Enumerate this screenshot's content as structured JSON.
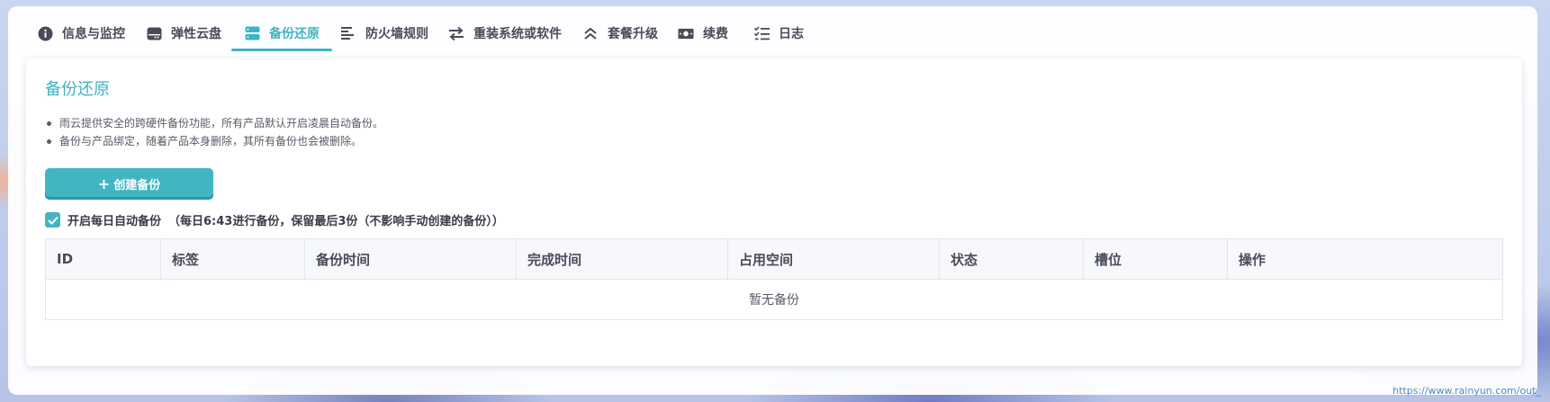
{
  "tabs": [
    {
      "label": "信息与监控",
      "icon": "info-icon",
      "active": false
    },
    {
      "label": "弹性云盘",
      "icon": "disk-icon",
      "active": false
    },
    {
      "label": "备份还原",
      "icon": "server-icon",
      "active": true
    },
    {
      "label": "防火墙规则",
      "icon": "lines-icon",
      "active": false
    },
    {
      "label": "重装系统或软件",
      "icon": "swap-icon",
      "active": false
    },
    {
      "label": "套餐升级",
      "icon": "double-chevron-up-icon",
      "active": false
    },
    {
      "label": "续费",
      "icon": "money-icon",
      "active": false
    },
    {
      "label": "日志",
      "icon": "checklist-icon",
      "active": false
    }
  ],
  "card": {
    "title": "备份还原",
    "notes": [
      "雨云提供安全的跨硬件备份功能，所有产品默认开启凌晨自动备份。",
      "备份与产品绑定，随着产品本身删除，其所有备份也会被删除。"
    ],
    "create_label": "创建备份",
    "auto_label": "开启每日自动备份",
    "auto_note": "（每日6:43进行备份，保留最后3份（不影响手动创建的备份））",
    "auto_checked": true
  },
  "table": {
    "columns": [
      "ID",
      "标签",
      "备份时间",
      "完成时间",
      "占用空间",
      "状态",
      "槽位",
      "操作"
    ],
    "empty_text": "暂无备份"
  },
  "footer": {
    "url": "https://www.rainyun.com/out_"
  },
  "colors": {
    "accent": "#3fb3c1",
    "button": "#41b6c2"
  }
}
